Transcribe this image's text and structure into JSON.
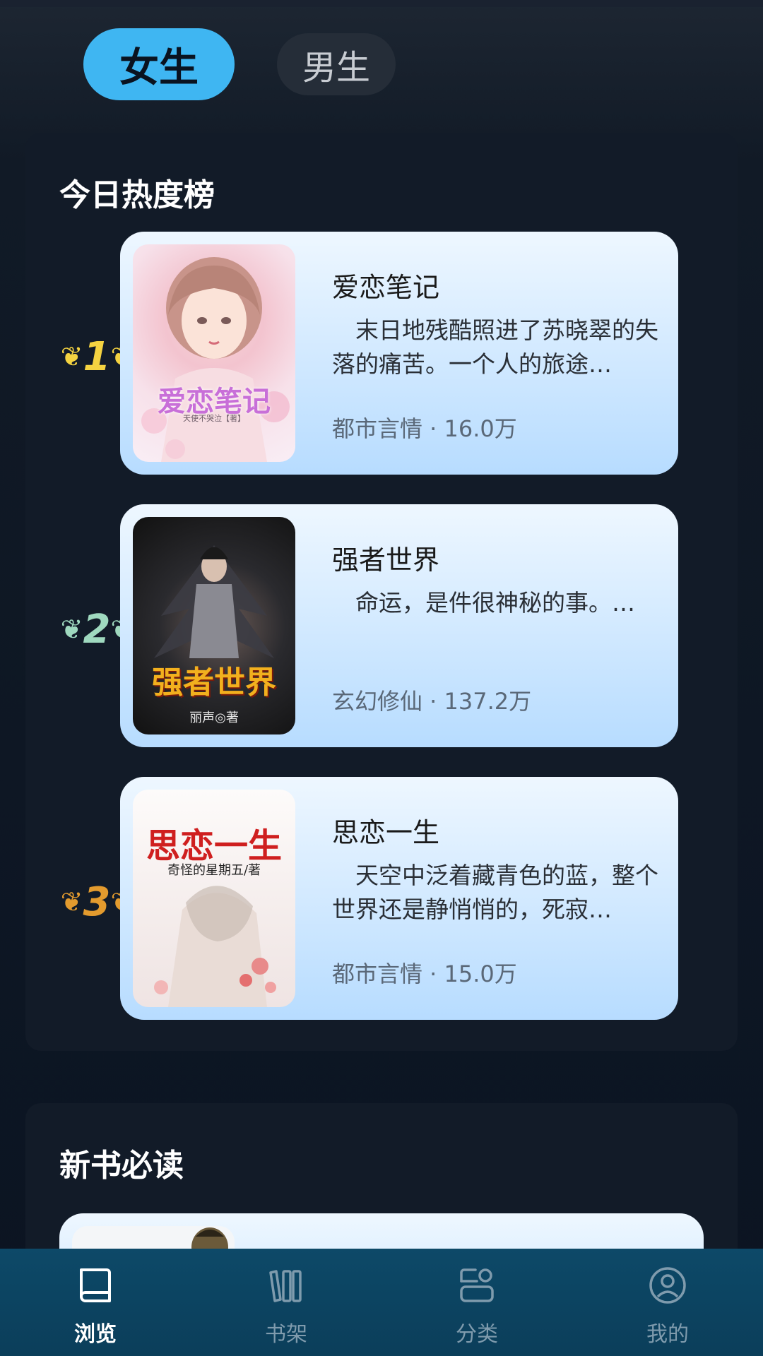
{
  "tabs": {
    "female": "女生",
    "male": "男生"
  },
  "hot": {
    "title": "今日热度榜",
    "books": [
      {
        "rank": "1",
        "title": "爱恋笔记",
        "desc": "末日地残酷照进了苏晓翠的失落的痛苦。一个人的旅途…",
        "meta": "都市言情 · 16.0万",
        "cover_title": "爱恋笔记",
        "cover_author": "天使不哭泣【著】",
        "rank_color": "#f4d341"
      },
      {
        "rank": "2",
        "title": "强者世界",
        "desc": "命运，是件很神秘的事。…",
        "meta": "玄幻修仙 · 137.2万",
        "cover_title": "强者世界",
        "cover_author": "丽声◎著",
        "rank_color": "#9fd9bf"
      },
      {
        "rank": "3",
        "title": "思恋一生",
        "desc": "天空中泛着藏青色的蓝，整个世界还是静悄悄的，死寂…",
        "meta": "都市言情 · 15.0万",
        "cover_title": "思恋一生",
        "cover_author": "奇怪的星期五/著",
        "rank_color": "#e39b2e"
      }
    ]
  },
  "new_books": {
    "title": "新书必读"
  },
  "nav": [
    {
      "label": "浏览",
      "icon": "book-icon",
      "active": true
    },
    {
      "label": "书架",
      "icon": "bookshelf-icon",
      "active": false
    },
    {
      "label": "分类",
      "icon": "category-icon",
      "active": false
    },
    {
      "label": "我的",
      "icon": "profile-icon",
      "active": false
    }
  ]
}
